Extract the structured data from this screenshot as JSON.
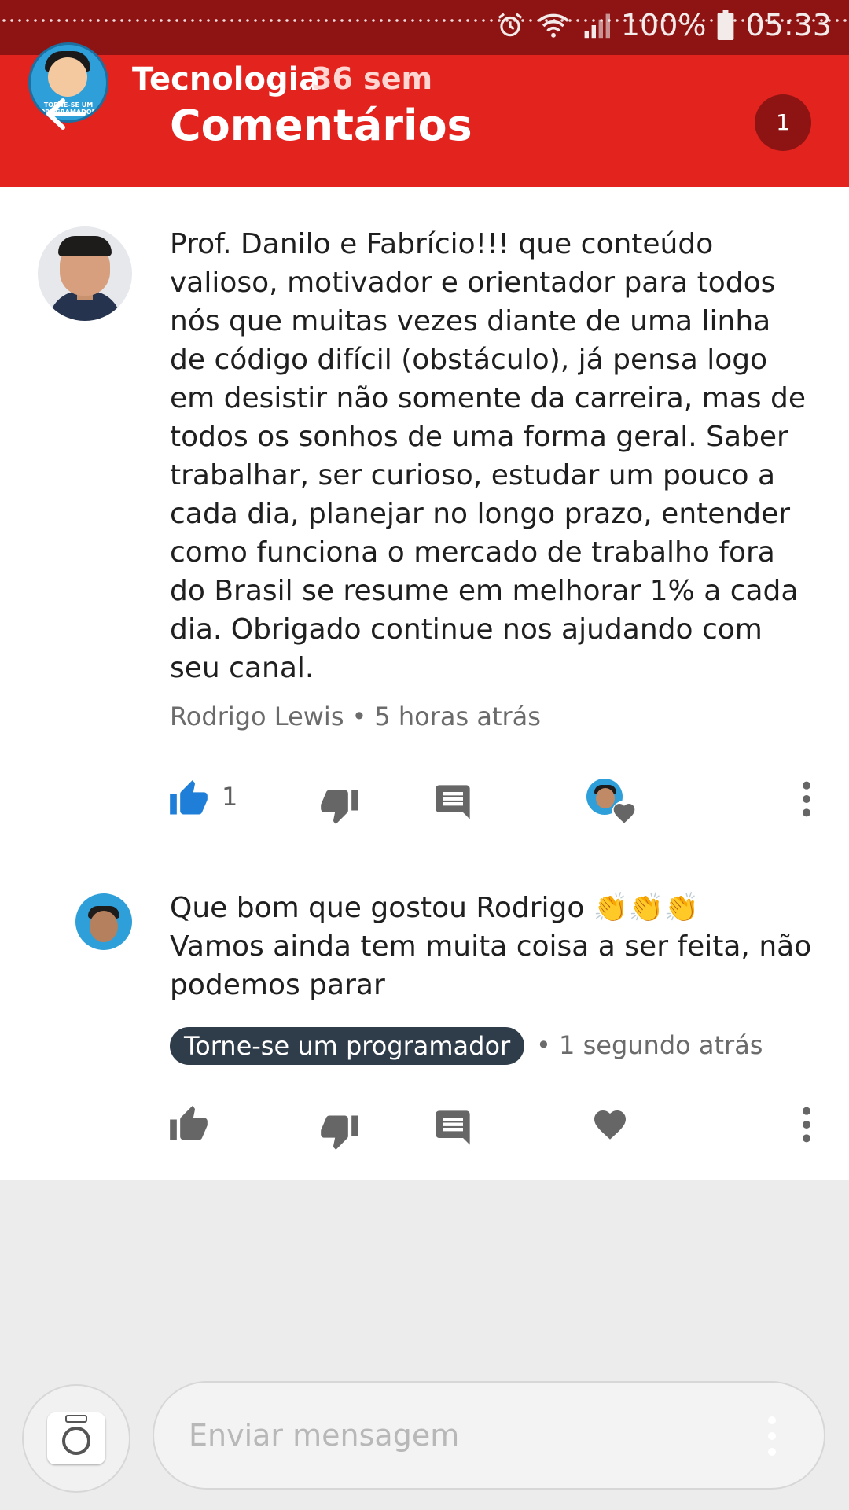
{
  "status_bar": {
    "battery": "100%",
    "time": "05:33"
  },
  "header": {
    "channel_name": "Tecnologia",
    "channel_age": "36 sem",
    "title": "Comentários",
    "count": "1",
    "channel_avatar_text": "TORNE-SE UM PROGRAMADOR"
  },
  "comment": {
    "text": "Prof. Danilo e Fabrício!!! que conteúdo valioso, motivador e orientador para todos nós que muitas vezes diante de uma linha de código difícil (obstáculo), já pensa logo em desistir não somente da carreira, mas de todos os sonhos de uma forma geral. Saber trabalhar, ser curioso, estudar um pouco a cada dia, planejar no longo prazo, entender como funciona o mercado de trabalho fora do Brasil se resume em melhorar 1% a cada dia. Obrigado continue nos ajudando com seu canal.",
    "author": "Rodrigo Lewis",
    "separator": "•",
    "time": "5 horas atrás",
    "like_count": "1"
  },
  "reply": {
    "text": "Que bom que gostou Rodrigo",
    "emoji": "👏👏👏",
    "text2": "Vamos ainda tem muita coisa a ser feita, não podemos parar",
    "author": "Torne-se um programador",
    "separator": "•",
    "time": "1 segundo atrás"
  },
  "composer": {
    "placeholder": "Enviar mensagem"
  },
  "colors": {
    "header": "#e2231e",
    "status_bar": "#8e1414",
    "like_active": "#1f7fd8",
    "chip": "#2f3c4a"
  }
}
